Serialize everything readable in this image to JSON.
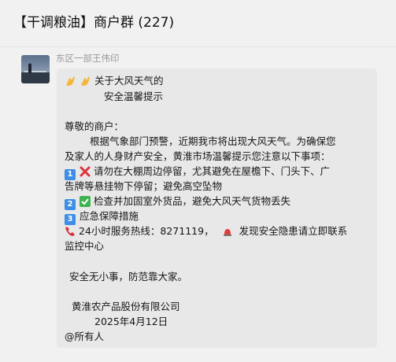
{
  "chat": {
    "title": "【干调粮油】商户群 (227)"
  },
  "message": {
    "sender": "东区一部王伟印",
    "title_line1": "关于大风天气的",
    "title_line2": "安全温馨提示",
    "greeting": "尊敬的商户：",
    "body_line1": "根据气象部门预警，近期我市将出现大风天气。为确保您",
    "body_line2": "及家人的人身财产安全，黄淮市场温馨提示您注意以下事项：",
    "item1_num": "1",
    "item1_line1": "请勿在大棚周边停留，尤其避免在屋檐下、门头下、广",
    "item1_line2": "告牌等悬挂物下停留；避免高空坠物",
    "item2_num": "2",
    "item2_text": "检查并加固室外货品，避免大风天气货物丢失",
    "item3_num": "3",
    "item3_text": "应急保障措施",
    "hotline_text": "24小时服务热线：8271119，",
    "report_text": "发现安全隐患请立即联系",
    "report_line2": "监控中心",
    "closing": "安全无小事，防范靠大家。",
    "company": "黄淮农产品股份有限公司",
    "date": "2025年4月12日",
    "mention": "@所有人"
  }
}
